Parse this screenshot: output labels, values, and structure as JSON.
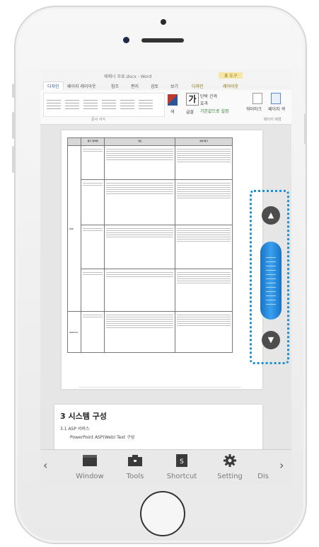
{
  "word": {
    "title": "제매너 자료.docx - Word",
    "context_tab": "표 도구",
    "tabs": [
      "디자인",
      "페이지 레이아웃",
      "참조",
      "편지",
      "검토",
      "보기",
      "디자인",
      "레이아웃"
    ],
    "active_tab_index": 0,
    "style_gallery_group": "문서 서식",
    "color_label": "색",
    "font_label": "글꼴",
    "para_spacing": "단락 간격",
    "effects": "효과",
    "set_default": "기본값으로 설정",
    "watermark": "워터마크",
    "page_color": "페이지 색",
    "page_bg_group": "페이지 배경"
  },
  "document": {
    "table_headers": [
      "평가 영역명",
      "개요",
      "세부 평가"
    ],
    "row_label_1": "ASP",
    "row_label_2": "Optimal",
    "next_section_title": "3 시스템 구성",
    "next_section_sub": "3.1 ASP 서비스",
    "next_section_sub2": "PowerPoint ASP(Web) Text 구성"
  },
  "toolbar": {
    "prev": "‹",
    "next": "›",
    "items": [
      {
        "label": "Window",
        "icon": "window-icon"
      },
      {
        "label": "Tools",
        "icon": "tools-icon"
      },
      {
        "label": "Shortcut",
        "icon": "shortcut-icon"
      },
      {
        "label": "Setting",
        "icon": "gear-icon"
      },
      {
        "label": "Dis",
        "icon": "display-icon"
      }
    ]
  },
  "scroll_control": {
    "up_icon": "▲",
    "down_icon": "▼"
  }
}
